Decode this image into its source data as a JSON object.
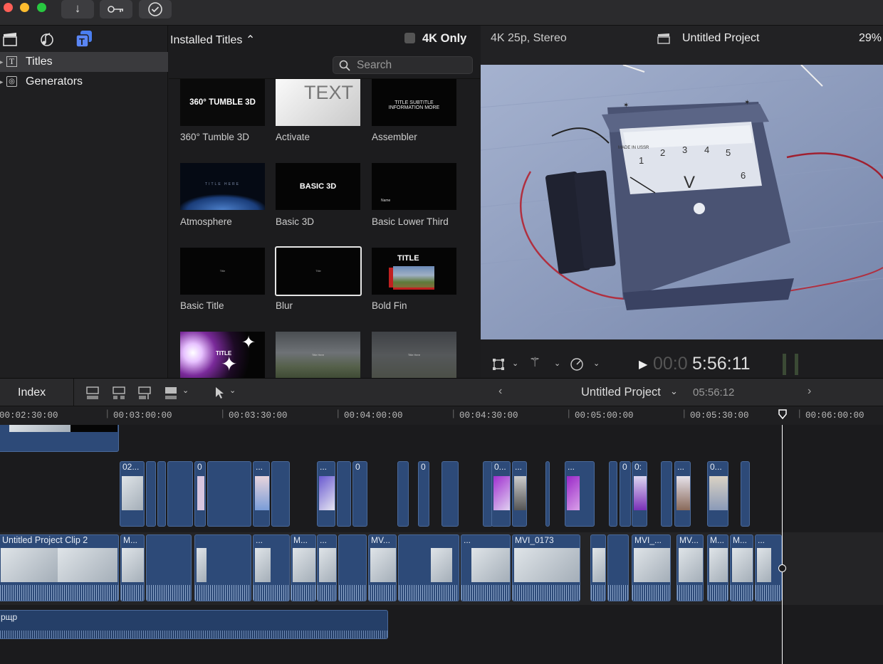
{
  "toolbar": {
    "import_icon": "arrow-down-icon",
    "keywords_icon": "key-icon",
    "check_icon": "check-icon"
  },
  "sidebar": {
    "items": [
      {
        "label": "Titles",
        "icon": "T-icon"
      },
      {
        "label": "Generators",
        "icon": "generators-icon"
      }
    ]
  },
  "browser": {
    "dropdown_label": "Installed Titles ⌃",
    "filter_label": "4K Only",
    "search_placeholder": "Search",
    "tiles": [
      {
        "label": "360° Tumble 3D",
        "thumb_text": "360° TUMBLE 3D"
      },
      {
        "label": "Activate",
        "thumb_text": "TEXT"
      },
      {
        "label": "Assembler",
        "thumb_text": "TITLE SUBTITLE INFORMATION MORE"
      },
      {
        "label": "Atmosphere",
        "thumb_text": "TITLE HERE"
      },
      {
        "label": "Basic 3D",
        "thumb_text": "BASIC 3D"
      },
      {
        "label": "Basic Lower Third",
        "thumb_text": "Name"
      },
      {
        "label": "Basic Title",
        "thumb_text": "Title"
      },
      {
        "label": "Blur",
        "thumb_text": "Title"
      },
      {
        "label": "Bold Fin",
        "thumb_text": "TITLE"
      },
      {
        "label": "",
        "thumb_text": "TITLE"
      },
      {
        "label": "",
        "thumb_text": "Title Here"
      },
      {
        "label": "",
        "thumb_text": "Title Here"
      }
    ]
  },
  "viewer": {
    "format": "4K 25p, Stereo",
    "project": "Untitled Project",
    "zoom": "29%",
    "timecode_dim": "00:0",
    "timecode": "5:56:11",
    "dial_numbers": [
      "1",
      "2",
      "3",
      "4",
      "5",
      "6"
    ],
    "dial_unit": "V",
    "brand": "MADE IN USSR"
  },
  "timeline": {
    "index_label": "Index",
    "project": "Untitled Project",
    "duration": "05:56:12",
    "ruler": [
      "00:02:30:00",
      "00:03:00:00",
      "00:03:30:00",
      "00:04:00:00",
      "00:04:30:00",
      "00:05:00:00",
      "00:05:30:00",
      "00:06:00:00"
    ],
    "clip_labels": {
      "main": "Untitled Project Clip 2",
      "mvi": "MVI_0173",
      "mvi2": "MVI_...",
      "mv": "MV...",
      "m": "M...",
      "dots": "...",
      "audio": "рщр",
      "c02": "02...",
      "c0": "0",
      "cdots0": "0...",
      "c0b": "0:"
    }
  },
  "colors": {
    "accent": "#4a7ef0",
    "clip": "#2d4a78",
    "playhead": "#ffffff"
  }
}
